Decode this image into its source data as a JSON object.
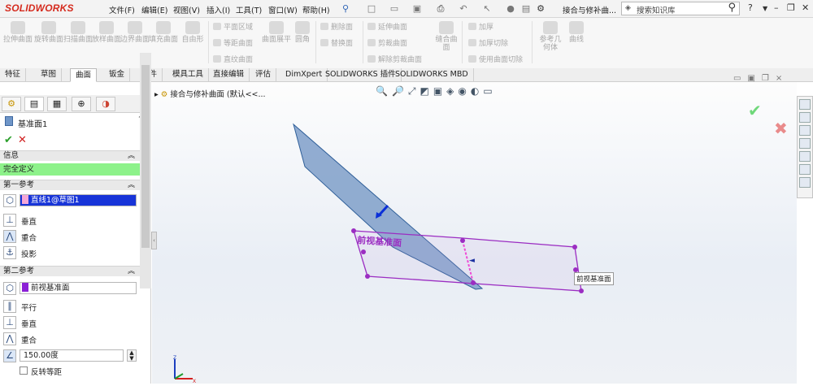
{
  "app": {
    "logo": "SOLIDWORKS",
    "doc_title": "接合与修补曲...",
    "search_placeholder": "搜索知识库"
  },
  "menus": [
    "文件(F)",
    "编辑(E)",
    "视图(V)",
    "插入(I)",
    "工具(T)",
    "窗口(W)",
    "帮助(H)"
  ],
  "ribbon": {
    "big_tools": [
      "拉伸曲面",
      "旋转曲面",
      "扫描曲面",
      "放样曲面",
      "边界曲面",
      "填充曲面",
      "自由形"
    ],
    "group1": [
      "平面区域",
      "等距曲面",
      "直纹曲面"
    ],
    "tool_flatten": "曲面展平",
    "tool_fillet": "圆角",
    "group2": [
      "删除面",
      "替换面"
    ],
    "group3": [
      "延伸曲面",
      "剪裁曲面",
      "解除剪裁曲面"
    ],
    "tool_knit": "缝合曲面",
    "group4": [
      "加厚",
      "加厚切除",
      "使用曲面切除"
    ],
    "tool_ref": "参考几何体",
    "tool_curve": "曲线"
  },
  "tabs": [
    "特征",
    "草图",
    "曲面",
    "钣金",
    "焊件",
    "模具工具",
    "直接编辑",
    "评估",
    "DimXpert",
    "SOLIDWORKS 插件",
    "SOLIDWORKS MBD"
  ],
  "panel": {
    "title": "基准面1",
    "help": "?",
    "msg_header": "信息",
    "status": "完全定义",
    "ref1": {
      "header": "第一参考",
      "value": "直线1@草图1",
      "options": [
        "垂直",
        "重合",
        "投影"
      ]
    },
    "ref2": {
      "header": "第二参考",
      "value": "前视基准面",
      "options": [
        "平行",
        "垂直",
        "重合"
      ],
      "angle": "150.00度",
      "reverse": "反转等距"
    }
  },
  "viewport": {
    "tree_label": "接合与修补曲面 (默认<<...",
    "plane_text": "前视基准面",
    "callout": "前视基准面"
  },
  "colors": {
    "status_bg": "#8df28a",
    "selection": "#0a2fd8",
    "plane": "#7f9fc9",
    "sketch": "#9b2dc2"
  }
}
